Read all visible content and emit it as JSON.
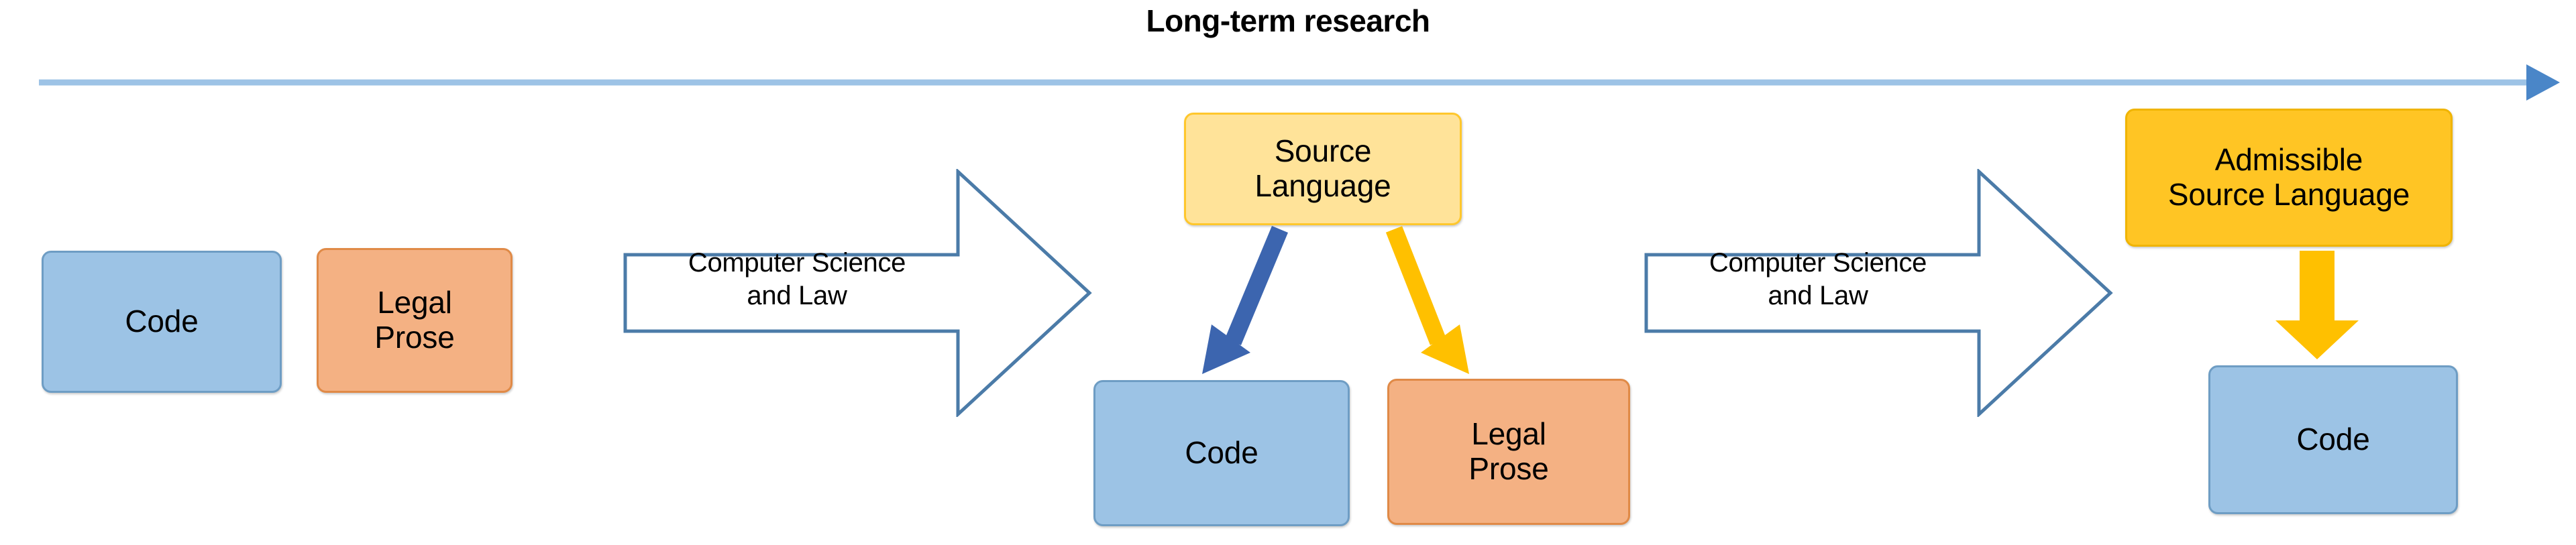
{
  "header": {
    "title": "Long-term research",
    "timeline_arrow": {
      "name": "long-term-research-timeline-arrow",
      "line_color": "#9DC3E6",
      "head_color": "#4A86C8",
      "direction": "right"
    }
  },
  "colors": {
    "code_fill": "#9CC3E5",
    "code_border": "#6E9DC4",
    "legal_prose_fill": "#F4B183",
    "legal_prose_border": "#E08A47",
    "source_language_fill": "#FFE399",
    "source_language_border": "#FFC72C",
    "admissible_fill": "#FFC524",
    "admissible_border": "#F0B400",
    "chevron_stroke": "#4B7BA8",
    "chevron_fill": "#FFFFFF",
    "blue_connector": "#3C65AF",
    "yellow_connector": "#FFC000",
    "text": "#000000",
    "background": "#FFFFFF"
  },
  "stages": {
    "stage_one": {
      "name": "current-state",
      "nodes": [
        {
          "id": "code-left",
          "label": "Code",
          "style": "blue"
        },
        {
          "id": "legal-prose-left",
          "label": "Legal\nProse",
          "style": "orange"
        }
      ]
    },
    "transition_one": {
      "name": "computer-science-and-law-arrow-1",
      "label": "Computer Science\nand Law"
    },
    "stage_two": {
      "name": "source-language-stage",
      "nodes": [
        {
          "id": "source-language",
          "label": "Source\nLanguage",
          "style": "yellow-light"
        },
        {
          "id": "code-middle",
          "label": "Code",
          "style": "blue"
        },
        {
          "id": "legal-prose-middle",
          "label": "Legal\nProse",
          "style": "orange"
        }
      ],
      "connectors": [
        {
          "id": "source-language-to-code",
          "color": "#3C65AF",
          "direction": "down-left"
        },
        {
          "id": "source-language-to-legal-prose",
          "color": "#FFC000",
          "direction": "down-right"
        }
      ]
    },
    "transition_two": {
      "name": "computer-science-and-law-arrow-2",
      "label": "Computer Science\nand Law"
    },
    "stage_three": {
      "name": "admissible-source-language-stage",
      "nodes": [
        {
          "id": "admissible-source-language",
          "label": "Admissible\nSource Language",
          "style": "yellow-solid"
        },
        {
          "id": "code-right",
          "label": "Code",
          "style": "blue"
        }
      ],
      "connectors": [
        {
          "id": "admissible-to-code",
          "color": "#FFC000",
          "direction": "down"
        }
      ]
    }
  }
}
